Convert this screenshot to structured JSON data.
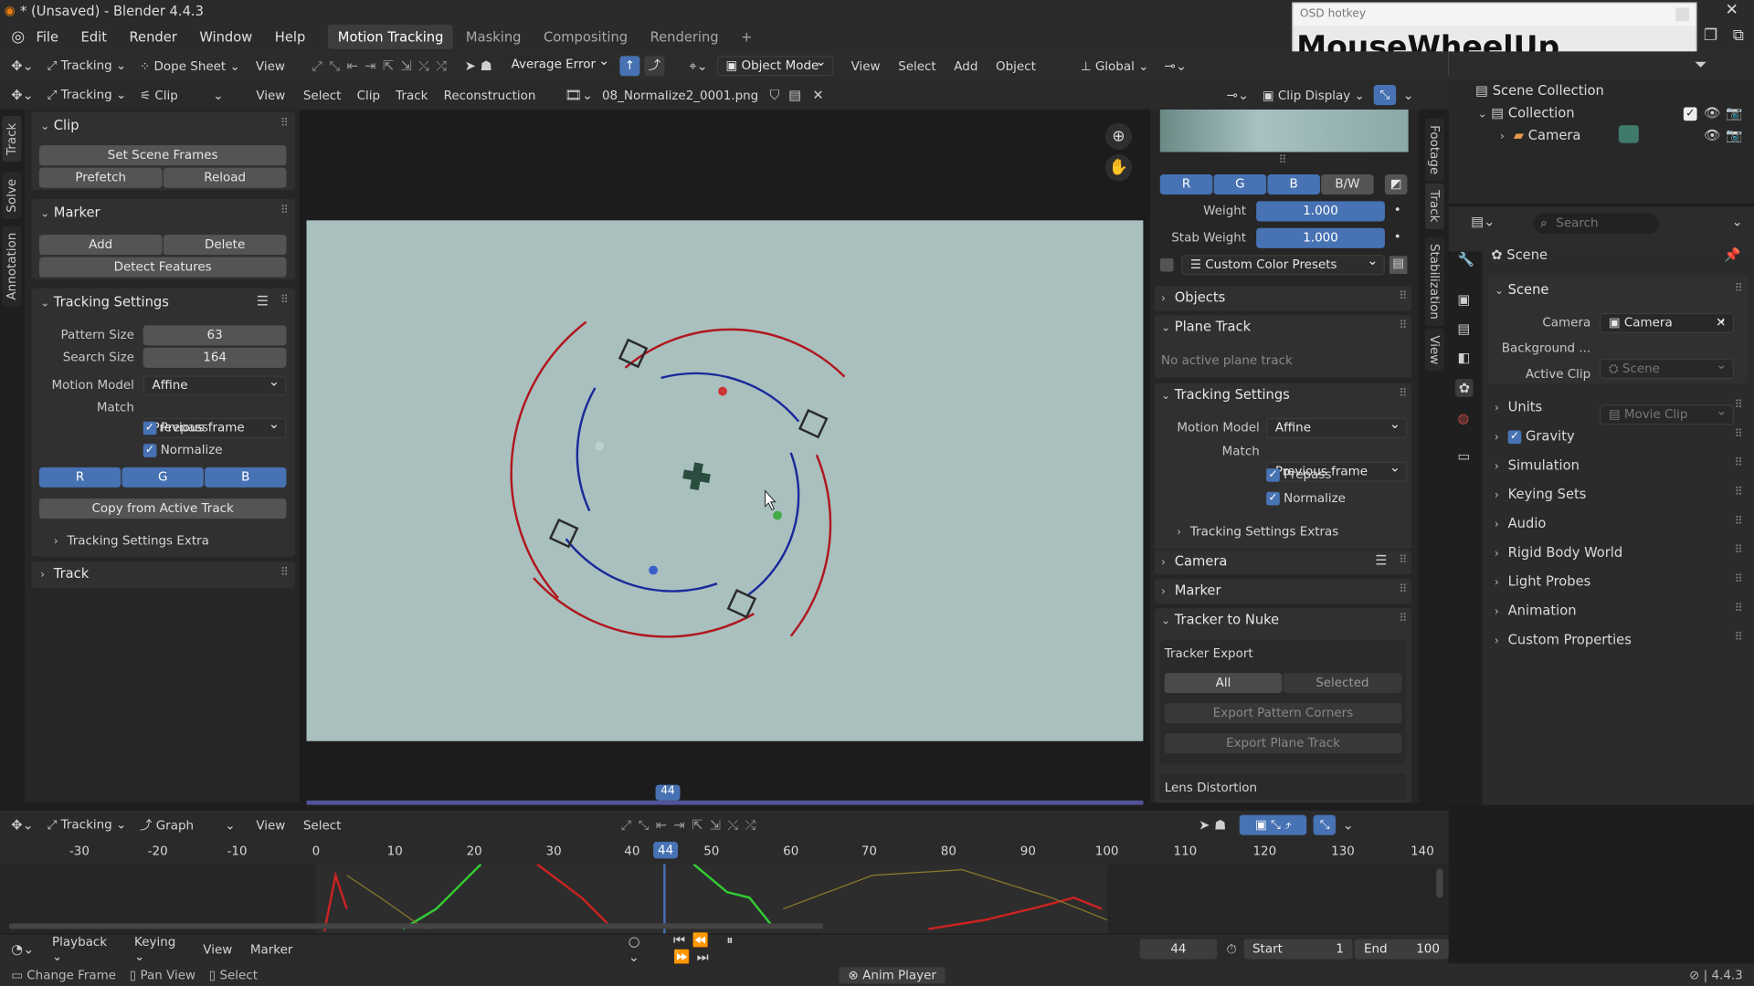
{
  "app": {
    "title": "* (Unsaved) - Blender 4.4.3",
    "version": "4.4.3"
  },
  "menu": [
    "File",
    "Edit",
    "Render",
    "Window",
    "Help"
  ],
  "workspaces": [
    "Motion Tracking",
    "Masking",
    "Compositing",
    "Rendering"
  ],
  "osd": {
    "title": "OSD hotkey",
    "text": "MouseWheelUp"
  },
  "toolbar1": {
    "mode": "Tracking",
    "dope": "Dope Sheet",
    "view": "View",
    "error": "Average Error",
    "object_mode": "Object Mode",
    "view2": "View",
    "select": "Select",
    "add": "Add",
    "object": "Object",
    "global": "Global"
  },
  "clip_header": {
    "mode": "Tracking",
    "clip": "Clip",
    "view": "View",
    "select": "Select",
    "clip2": "Clip",
    "track": "Track",
    "reconstruction": "Reconstruction",
    "file": "08_Normalize2_0001.png",
    "clip_display": "Clip Display"
  },
  "left_tabs": [
    "Track",
    "Solve",
    "Annotation"
  ],
  "clip_panel": {
    "title": "Clip",
    "set_scene_frames": "Set Scene Frames",
    "prefetch": "Prefetch",
    "reload": "Reload"
  },
  "marker_panel": {
    "title": "Marker",
    "add": "Add",
    "delete": "Delete",
    "detect": "Detect Features"
  },
  "tracking_settings": {
    "title": "Tracking Settings",
    "pattern_size_label": "Pattern Size",
    "pattern_size": "63",
    "search_size_label": "Search Size",
    "search_size": "164",
    "motion_model_label": "Motion Model",
    "motion_model": "Affine",
    "match_label": "Match",
    "match": "Previous frame",
    "prepass": "Prepass",
    "normalize": "Normalize",
    "r": "R",
    "g": "G",
    "b": "B",
    "copy": "Copy from Active Track",
    "extra": "Tracking Settings Extra"
  },
  "track_panel": {
    "title": "Track"
  },
  "frame_marker": "44",
  "right_tabs": [
    "Footage",
    "Track",
    "Stabilization",
    "View"
  ],
  "track_sidebar": {
    "r": "R",
    "g": "G",
    "b": "B",
    "bw": "B/W",
    "weight_label": "Weight",
    "weight": "1.000",
    "stab_label": "Stab Weight",
    "stab": "1.000",
    "presets": "Custom Color Presets",
    "objects": "Objects",
    "plane_track": "Plane Track",
    "no_plane": "No active plane track",
    "tracking_settings": "Tracking Settings",
    "motion_model_label": "Motion Model",
    "motion_model": "Affine",
    "match_label": "Match",
    "match": "Previous frame",
    "prepass": "Prepass",
    "normalize": "Normalize",
    "extras": "Tracking Settings Extras",
    "camera": "Camera",
    "marker": "Marker",
    "nuke": "Tracker to Nuke",
    "tracker_export": "Tracker Export",
    "all": "All",
    "selected": "Selected",
    "export_corners": "Export Pattern Corners",
    "export_plane": "Export Plane Track",
    "lens": "Lens Distortion"
  },
  "outliner": {
    "scene_collection": "Scene Collection",
    "collection": "Collection",
    "camera": "Camera"
  },
  "properties": {
    "search_placeholder": "Search",
    "scene_tab": "Scene",
    "scene_section": "Scene",
    "camera_label": "Camera",
    "camera": "Camera",
    "background_label": "Background ...",
    "background": "Scene",
    "active_clip_label": "Active Clip",
    "active_clip": "Movie Clip",
    "sections": [
      "Units",
      "Gravity",
      "Simulation",
      "Keying Sets",
      "Audio",
      "Rigid Body World",
      "Light Probes",
      "Animation",
      "Custom Properties"
    ]
  },
  "graph_header": {
    "mode": "Tracking",
    "graph": "Graph",
    "view": "View",
    "select": "Select"
  },
  "graph_ruler": [
    "-30",
    "-20",
    "-10",
    "0",
    "10",
    "20",
    "30",
    "40",
    "44",
    "50",
    "60",
    "70",
    "80",
    "90",
    "100",
    "110",
    "120",
    "130",
    "140"
  ],
  "timeline": {
    "playback": "Playback",
    "keying": "Keying",
    "view": "View",
    "marker": "Marker",
    "current": "44",
    "start_label": "Start",
    "start": "1",
    "end_label": "End",
    "end": "100"
  },
  "statusbar": {
    "change_frame": "Change Frame",
    "pan_view": "Pan View",
    "select": "Select",
    "anim_player": "Anim Player",
    "version": "4.4.3"
  },
  "colors": {
    "accent": "#4772b3",
    "red_curve": "#b0171e",
    "blue_curve": "#1a2a9a",
    "clip_bg": "#a9c0bf"
  }
}
